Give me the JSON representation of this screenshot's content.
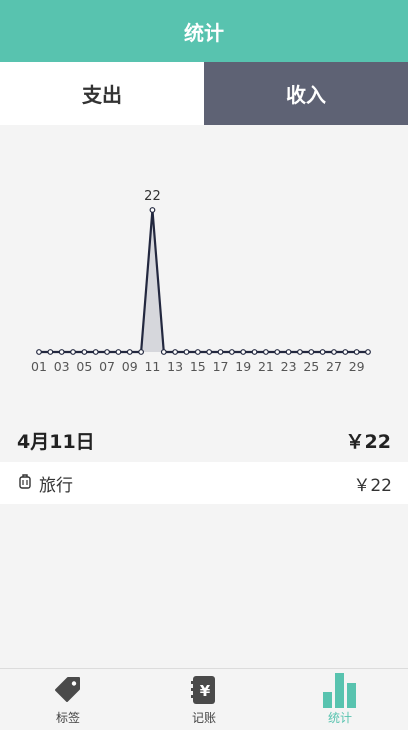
{
  "header": {
    "title": "统计"
  },
  "tabs": [
    {
      "label": "支出",
      "active": false
    },
    {
      "label": "收入",
      "active": true
    }
  ],
  "chart_data": {
    "type": "area",
    "x": [
      1,
      2,
      3,
      4,
      5,
      6,
      7,
      8,
      9,
      10,
      11,
      12,
      13,
      14,
      15,
      16,
      17,
      18,
      19,
      20,
      21,
      22,
      23,
      24,
      25,
      26,
      27,
      28,
      29,
      30
    ],
    "values": [
      0,
      0,
      0,
      0,
      0,
      0,
      0,
      0,
      0,
      0,
      22,
      0,
      0,
      0,
      0,
      0,
      0,
      0,
      0,
      0,
      0,
      0,
      0,
      0,
      0,
      0,
      0,
      0,
      0,
      0
    ],
    "tick_labels": [
      "01",
      "03",
      "05",
      "07",
      "09",
      "11",
      "13",
      "15",
      "17",
      "19",
      "21",
      "23",
      "25",
      "27",
      "29"
    ],
    "data_labels": [
      {
        "x": 11,
        "value": "22"
      }
    ],
    "colors": {
      "line": "#23283f",
      "fill": "#d6d7dc",
      "point_fill": "#ffffff"
    }
  },
  "day_summary": {
    "date": "4月11日",
    "total": "￥22"
  },
  "records": [
    {
      "icon": "luggage-icon",
      "category": "旅行",
      "amount": "￥22"
    }
  ],
  "bottom_nav": [
    {
      "label": "标签",
      "icon": "tag-icon",
      "active": false
    },
    {
      "label": "记账",
      "icon": "ledger-yen-icon",
      "active": false
    },
    {
      "label": "统计",
      "icon": "bar-chart-icon",
      "active": true
    }
  ],
  "colors": {
    "accent": "#58c3af",
    "tab_active_bg": "#5e6274"
  }
}
